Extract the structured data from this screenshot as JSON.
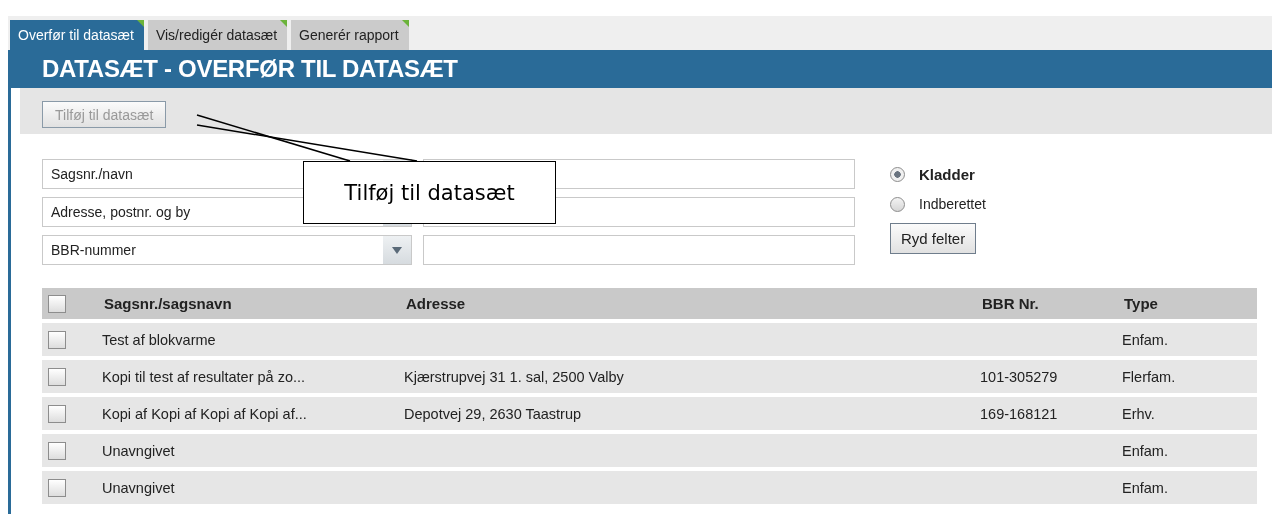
{
  "tabs": [
    {
      "label": "Overfør til datasæt",
      "selected": true
    },
    {
      "label": "Vis/redigér datasæt",
      "selected": false
    },
    {
      "label": "Generér rapport",
      "selected": false
    }
  ],
  "header": {
    "title": "DATASÆT - OVERFØR TIL DATASÆT"
  },
  "toolbar": {
    "add_button": {
      "label": "Tilføj til datasæt",
      "disabled": true
    }
  },
  "callout": {
    "text": "Tilføj til datasæt"
  },
  "filters": [
    {
      "selected_option": "Sagsnr./navn"
    },
    {
      "selected_option": "Adresse, postnr. og by"
    },
    {
      "selected_option": "BBR-nummer"
    }
  ],
  "status_options": [
    {
      "label": "Kladder",
      "selected": true
    },
    {
      "label": "Indberettet",
      "selected": false
    }
  ],
  "clear_button": {
    "label": "Ryd felter"
  },
  "table": {
    "header_checked": false,
    "columns": [
      "Sagsnr./sagsnavn",
      "Adresse",
      "BBR Nr.",
      "Type"
    ],
    "rows": [
      {
        "checked": false,
        "cells": [
          "Test af blokvarme",
          "",
          "",
          "Enfam."
        ]
      },
      {
        "checked": false,
        "cells": [
          "Kopi til test af resultater på zo...",
          "Kjærstrupvej 31 1. sal, 2500 Valby",
          "101-305279",
          "Flerfam."
        ]
      },
      {
        "checked": false,
        "cells": [
          "Kopi af Kopi af Kopi af Kopi af...",
          "Depotvej 29, 2630 Taastrup",
          "169-168121",
          "Erhv."
        ]
      },
      {
        "checked": false,
        "cells": [
          "Unavngivet",
          "",
          "",
          "Enfam."
        ]
      },
      {
        "checked": false,
        "cells": [
          "Unavngivet",
          "",
          "",
          "Enfam."
        ]
      }
    ]
  }
}
